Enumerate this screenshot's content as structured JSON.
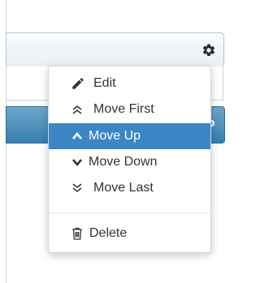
{
  "menu": {
    "items": [
      {
        "label": "Edit",
        "icon": "pencil-icon"
      },
      {
        "label": "Move First",
        "icon": "double-chevron-up-icon"
      },
      {
        "label": "Move Up",
        "icon": "chevron-up-icon",
        "active": true
      },
      {
        "label": "Move Down",
        "icon": "chevron-down-icon"
      },
      {
        "label": "Move Last",
        "icon": "double-chevron-down-icon"
      },
      {
        "label": "Delete",
        "icon": "trash-icon"
      }
    ]
  },
  "colors": {
    "accent": "#3d86c6",
    "text": "#333333"
  }
}
